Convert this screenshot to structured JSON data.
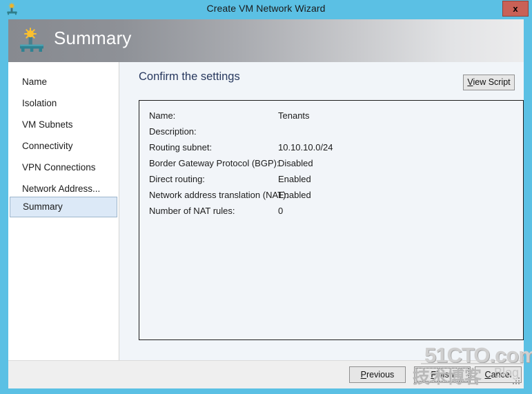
{
  "window": {
    "title": "Create VM Network Wizard",
    "icon": "vm-network-icon",
    "close_label": "x"
  },
  "banner": {
    "title": "Summary",
    "icon": "vm-network-summary-icon"
  },
  "sidebar": {
    "items": [
      {
        "label": "Name",
        "selected": false
      },
      {
        "label": "Isolation",
        "selected": false
      },
      {
        "label": "VM Subnets",
        "selected": false
      },
      {
        "label": "Connectivity",
        "selected": false
      },
      {
        "label": "VPN Connections",
        "selected": false
      },
      {
        "label": "Network Address...",
        "selected": false
      },
      {
        "label": "Summary",
        "selected": true
      }
    ]
  },
  "content": {
    "heading": "Confirm the settings",
    "view_script_label": "View Script",
    "view_script_accel": "V",
    "settings": [
      {
        "label": "Name:",
        "value": "Tenants"
      },
      {
        "label": "Description:",
        "value": ""
      },
      {
        "label": "Routing subnet:",
        "value": "10.10.10.0/24"
      },
      {
        "label": "Border Gateway Protocol (BGP):",
        "value": "Disabled"
      },
      {
        "label": "Direct routing:",
        "value": "Enabled"
      },
      {
        "label": "Network address translation (NAT):",
        "value": "Enabled"
      },
      {
        "label": "Number of NAT rules:",
        "value": "0"
      }
    ]
  },
  "footer": {
    "previous_label": "Previous",
    "previous_accel": "P",
    "finish_label": "Finish",
    "finish_accel": "F",
    "cancel_label": "Cancel",
    "cancel_accel": "C"
  },
  "watermark": {
    "main": "51CTO.com",
    "sub_cn": "技术博客",
    "sub_en": "Blog"
  },
  "colors": {
    "titlebar": "#5bc0e4",
    "close_button": "#c96156",
    "selected_nav": "#dce9f7",
    "heading": "#28395f",
    "content_bg": "#f1f5f9"
  }
}
